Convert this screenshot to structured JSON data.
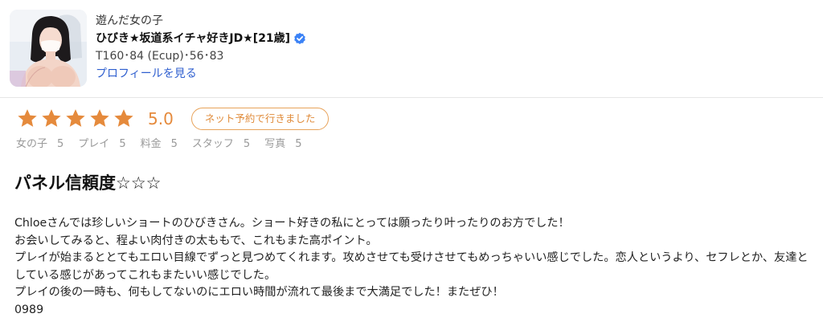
{
  "profile": {
    "played_label": "遊んだ女の子",
    "name": "ひびき★坂道系イチャ好きJD★[21歳]",
    "specs": "T160･84 (Ecup)･56･83",
    "profile_link": "プロフィールを見る",
    "verified_icon": "verified-check-icon",
    "verified_color": "#3b82f6"
  },
  "rating": {
    "stars": 5,
    "score": "5.0",
    "star_color": "#e58a3c",
    "badge": "ネット予約で行きました",
    "sub_ratings": [
      {
        "label": "女の子",
        "value": "5"
      },
      {
        "label": "プレイ",
        "value": "5"
      },
      {
        "label": "料金",
        "value": "5"
      },
      {
        "label": "スタッフ",
        "value": "5"
      },
      {
        "label": "写真",
        "value": "5"
      }
    ]
  },
  "review": {
    "title": "パネル信頼度☆☆☆",
    "lines": [
      "Chloeさんでは珍しいショートのひびきさん。ショート好きの私にとっては願ったり叶ったりのお方でした！",
      "お会いしてみると、程よい肉付きの太ももで、これもまた高ポイント。",
      "プレイが始まるととてもエロい目線でずっと見つめてくれます。攻めさせても受けさせてもめっちゃいい感じでした。恋人というより、セフレとか、友達としている感じがあってこれもまたいい感じでした。",
      "プレイの後の一時も、何もしてないのにエロい時間が流れて最後まで大満足でした！またぜひ！",
      "0989"
    ]
  }
}
